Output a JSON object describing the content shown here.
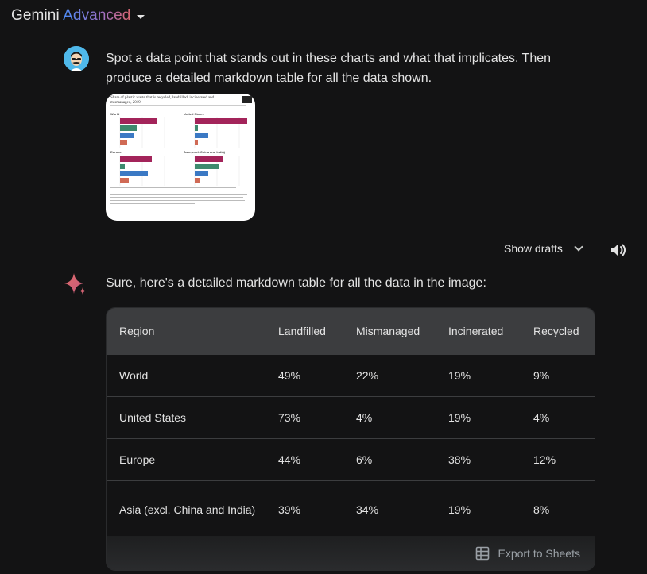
{
  "header": {
    "brand_main": "Gemini",
    "brand_accent": "Advanced",
    "dropdown_icon": "caret-down-icon"
  },
  "user_turn": {
    "avatar_icon": "user-avatar",
    "prompt": "Spot a data point that stands out in these charts and what that implicates. Then produce a detailed markdown table for all the data shown.",
    "attachment_title": "Share of plastic waste that is recycled, landfilled, incinerated and mismanaged, 2019",
    "attachment_panels": [
      "World",
      "United States",
      "Europe",
      "Asia (excl. China and India)"
    ]
  },
  "response_controls": {
    "show_drafts_label": "Show drafts",
    "chevron_icon": "chevron-down-icon",
    "speaker_icon": "speaker-icon"
  },
  "response": {
    "sparkle_icon": "gemini-sparkle-icon",
    "intro": "Sure, here's a detailed markdown table for all the data in the image:",
    "table": {
      "headers": [
        "Region",
        "Landfilled",
        "Mismanaged",
        "Incinerated",
        "Recycled"
      ],
      "rows": [
        [
          "World",
          "49%",
          "22%",
          "19%",
          "9%"
        ],
        [
          "United States",
          "73%",
          "4%",
          "19%",
          "4%"
        ],
        [
          "Europe",
          "44%",
          "6%",
          "38%",
          "12%"
        ],
        [
          "Asia (excl. China and India)",
          "39%",
          "34%",
          "19%",
          "8%"
        ]
      ]
    },
    "export_label": "Export to Sheets",
    "export_icon": "sheets-icon"
  },
  "colors": {
    "background": "#131314",
    "header_row": "#3c3d3f",
    "landfilled_bar": "#a3245a",
    "mismanaged_bar": "#3e8a6e",
    "incinerated_bar": "#3b79c4",
    "recycled_bar": "#d06a55"
  }
}
